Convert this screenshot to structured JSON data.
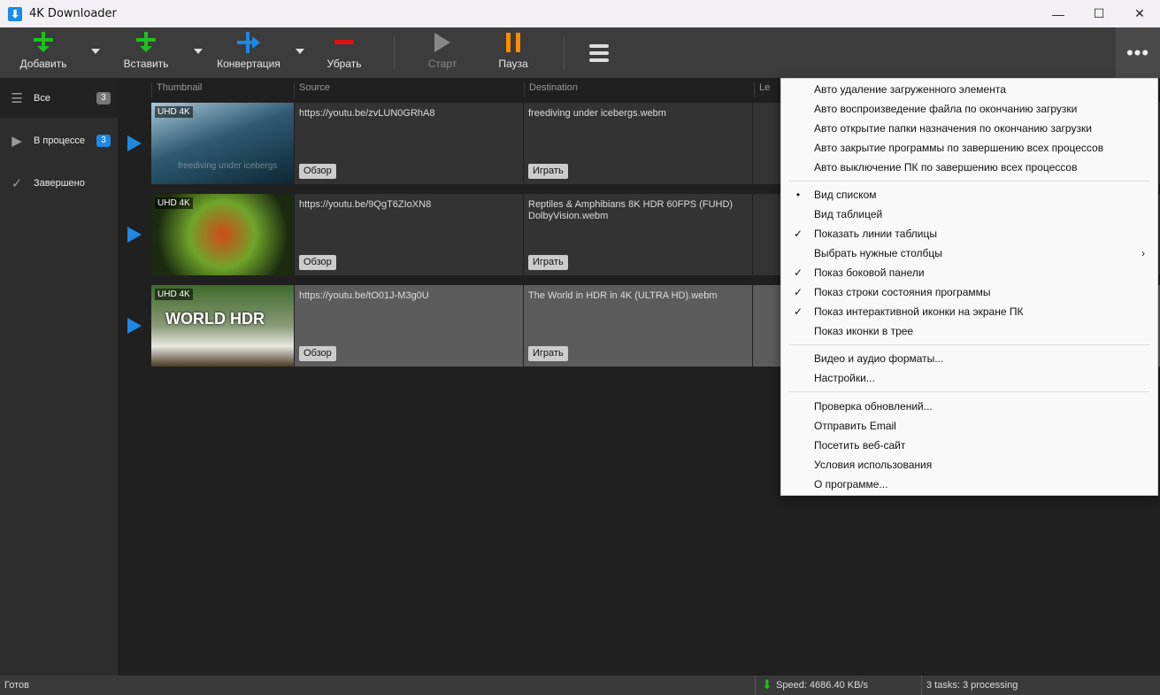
{
  "window": {
    "title": "4K Downloader",
    "minimize": "—",
    "maximize": "☐",
    "close": "✕"
  },
  "toolbar": {
    "add": "Добавить",
    "paste": "Вставить",
    "convert": "Конвертация",
    "remove": "Убрать",
    "start": "Старт",
    "pause": "Пауза",
    "more": "•••"
  },
  "sidebar": {
    "items": [
      {
        "label": "Все",
        "count": "3"
      },
      {
        "label": "В процессе",
        "count": "3"
      },
      {
        "label": "Завершено"
      }
    ]
  },
  "columns": [
    "Thumbnail",
    "Source",
    "Destination",
    "Le"
  ],
  "rows": [
    {
      "badge": "UHD 4K",
      "source": "https://youtu.be/zvLUN0GRhA8",
      "destination": "freediving under icebergs.webm",
      "browse": "Обзор",
      "play": "Играть",
      "thumb_text": "freediving under icebergs"
    },
    {
      "badge": "UHD 4K",
      "source": "https://youtu.be/9QgT6ZIoXN8",
      "destination": "Reptiles & Amphibians 8K HDR 60FPS (FUHD) DolbyVision.webm",
      "browse": "Обзор",
      "play": "Играть"
    },
    {
      "badge": "UHD 4K",
      "source": "https://youtu.be/tO01J-M3g0U",
      "destination": "The World in HDR in 4K (ULTRA HD).webm",
      "browse": "Обзор",
      "play": "Играть",
      "thumb_text": "WORLD HDR"
    }
  ],
  "menu": {
    "items": [
      {
        "label": "Авто удаление загруженного элемента",
        "mark": ""
      },
      {
        "label": "Авто воспроизведение файла по окончанию загрузки",
        "mark": ""
      },
      {
        "label": "Авто открытие папки назначения по окончанию загрузки",
        "mark": ""
      },
      {
        "label": "Авто закрытие программы по завершению всех процессов",
        "mark": ""
      },
      {
        "label": "Авто выключение ПК по завершению всех процессов",
        "mark": ""
      },
      {
        "label": "Вид списком",
        "mark": "•"
      },
      {
        "label": "Вид таблицей",
        "mark": ""
      },
      {
        "label": "Показать линии таблицы",
        "mark": "✓"
      },
      {
        "label": "Выбрать нужные столбцы",
        "mark": "",
        "submenu": "›"
      },
      {
        "label": "Показ боковой панели",
        "mark": "✓"
      },
      {
        "label": "Показ строки состояния программы",
        "mark": "✓"
      },
      {
        "label": "Показ интерактивной иконки на экране ПК",
        "mark": "✓"
      },
      {
        "label": "Показ иконки в трее",
        "mark": ""
      },
      {
        "label": "Видео и аудио форматы...",
        "mark": ""
      },
      {
        "label": "Настройки...",
        "mark": ""
      },
      {
        "label": "Проверка обновлений...",
        "mark": ""
      },
      {
        "label": "Отправить Email",
        "mark": ""
      },
      {
        "label": "Посетить веб-сайт",
        "mark": ""
      },
      {
        "label": "Условия использования",
        "mark": ""
      },
      {
        "label": "О программе...",
        "mark": ""
      }
    ]
  },
  "status": {
    "ready": "Готов",
    "speed": "Speed: 4686.40 KB/s",
    "tasks": "3 tasks: 3 processing"
  },
  "colors": {
    "accent": "#1e88e5",
    "green": "#1fbf1f",
    "orange": "#ff8c00",
    "red": "#e01010"
  }
}
